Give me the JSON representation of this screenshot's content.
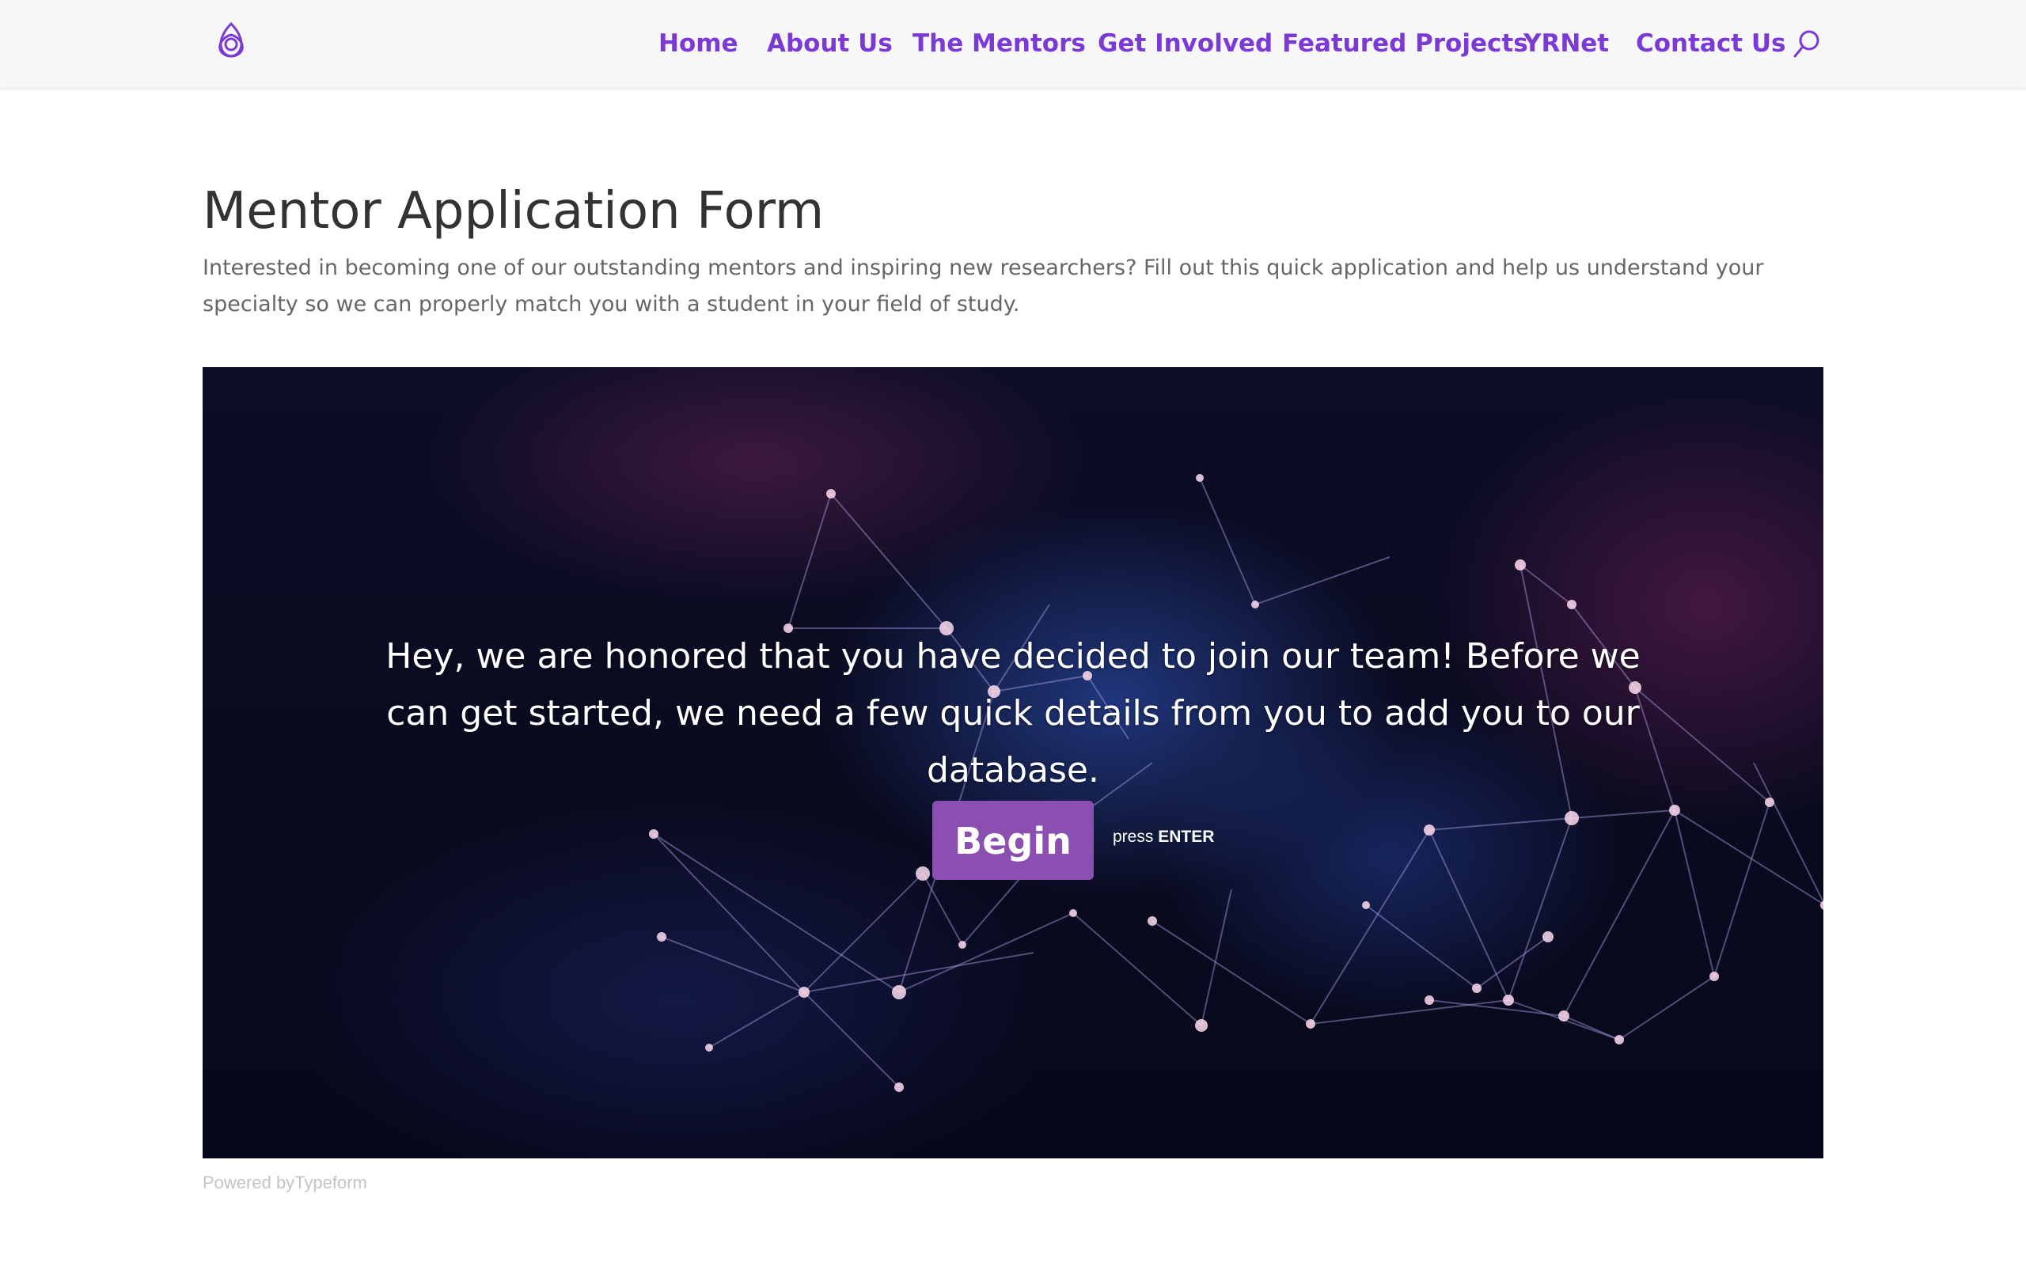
{
  "header": {
    "logo_icon": "triquetra-knot-logo",
    "nav": [
      {
        "label": "Home"
      },
      {
        "label": "About Us"
      },
      {
        "label": "The Mentors"
      },
      {
        "label": "Get Involved"
      },
      {
        "label": "Featured Projects"
      },
      {
        "label": "YRNet"
      },
      {
        "label": "Contact Us"
      }
    ],
    "search_icon": "search-icon",
    "accent_color": "#7b3ad6"
  },
  "main": {
    "title": "Mentor Application Form",
    "intro": "Interested in becoming one of our outstanding mentors and inspiring new researchers? Fill out this quick application and help us understand your specialty so we can properly match you with a student in your field of study."
  },
  "embed": {
    "message": "Hey, we are honored that you have decided to join our team! Before we can get started, we need a few quick details from you to add you to our database.",
    "begin_label": "Begin",
    "press_prefix": "press",
    "press_key": "ENTER",
    "button_color": "#8a4fb0",
    "powered_prefix": "Powered by",
    "powered_brand": "Typeform"
  }
}
